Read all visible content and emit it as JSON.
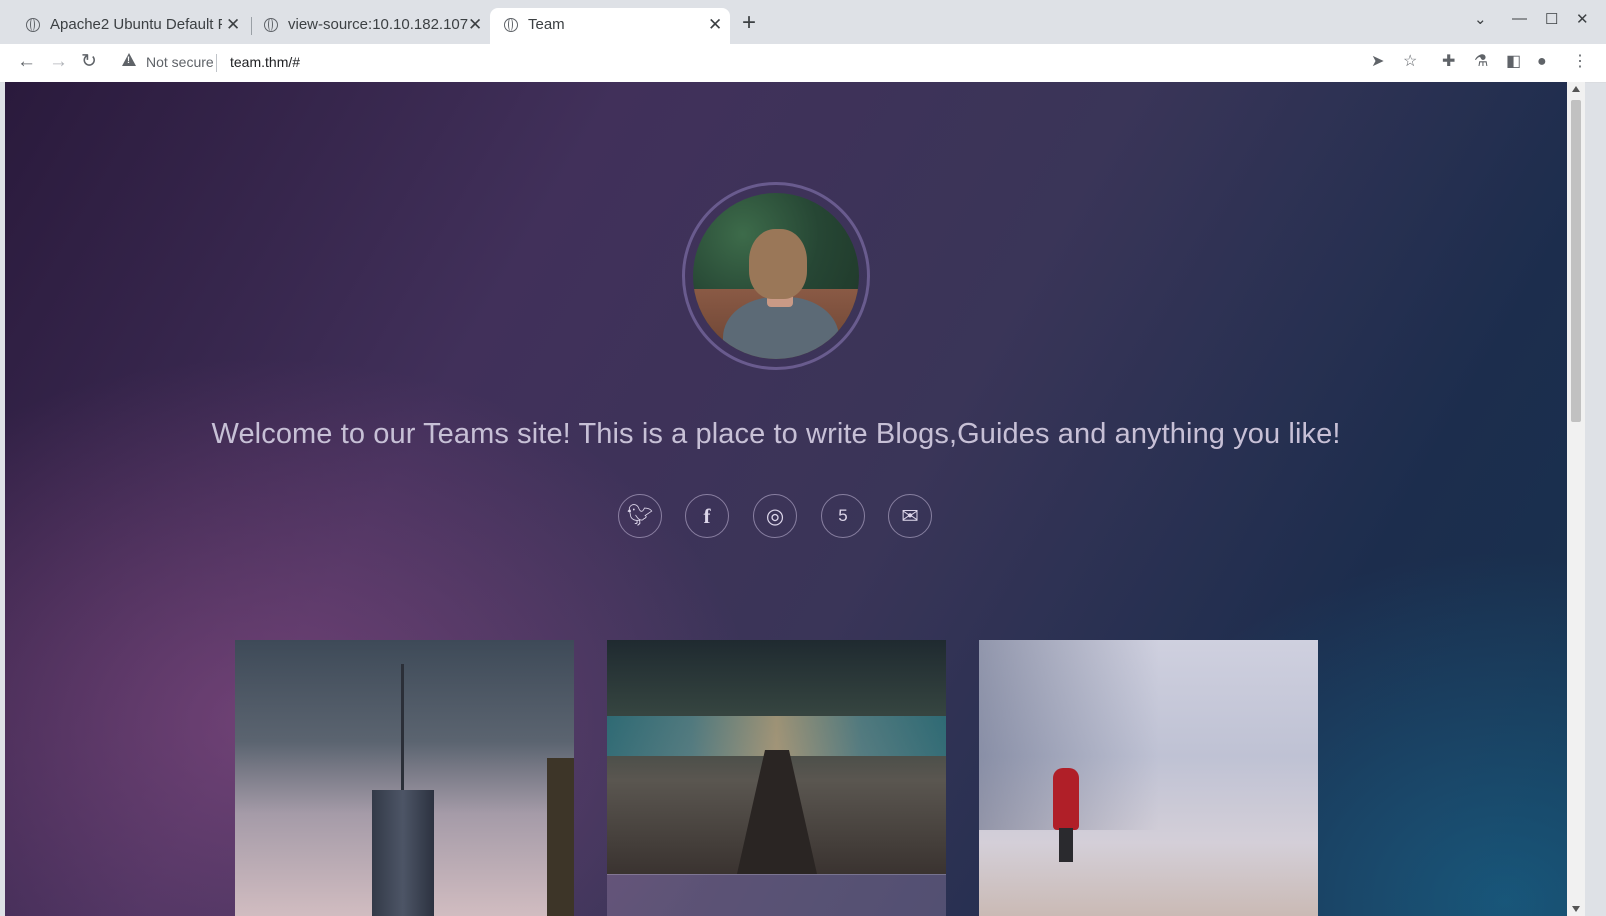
{
  "browser": {
    "tabs": [
      {
        "title": "Apache2 Ubuntu Default P",
        "active": false
      },
      {
        "title": "view-source:10.10.182.107",
        "active": false
      },
      {
        "title": "Team",
        "active": true
      }
    ],
    "security_label": "Not secure",
    "url": "team.thm/#"
  },
  "page": {
    "welcome_text": "Welcome to our Teams site! This is a place to write Blogs,Guides and anything you like!",
    "social_links": [
      "twitter-icon",
      "facebook-icon",
      "instagram-icon",
      "500px-icon",
      "mail-icon"
    ],
    "gallery": [
      "city-tower-image",
      "escalator-image",
      "snow-person-image"
    ]
  },
  "colors": {
    "gradient_purple": "#41305a",
    "gradient_blue": "#17334f",
    "accent_pink": "#96508c"
  }
}
